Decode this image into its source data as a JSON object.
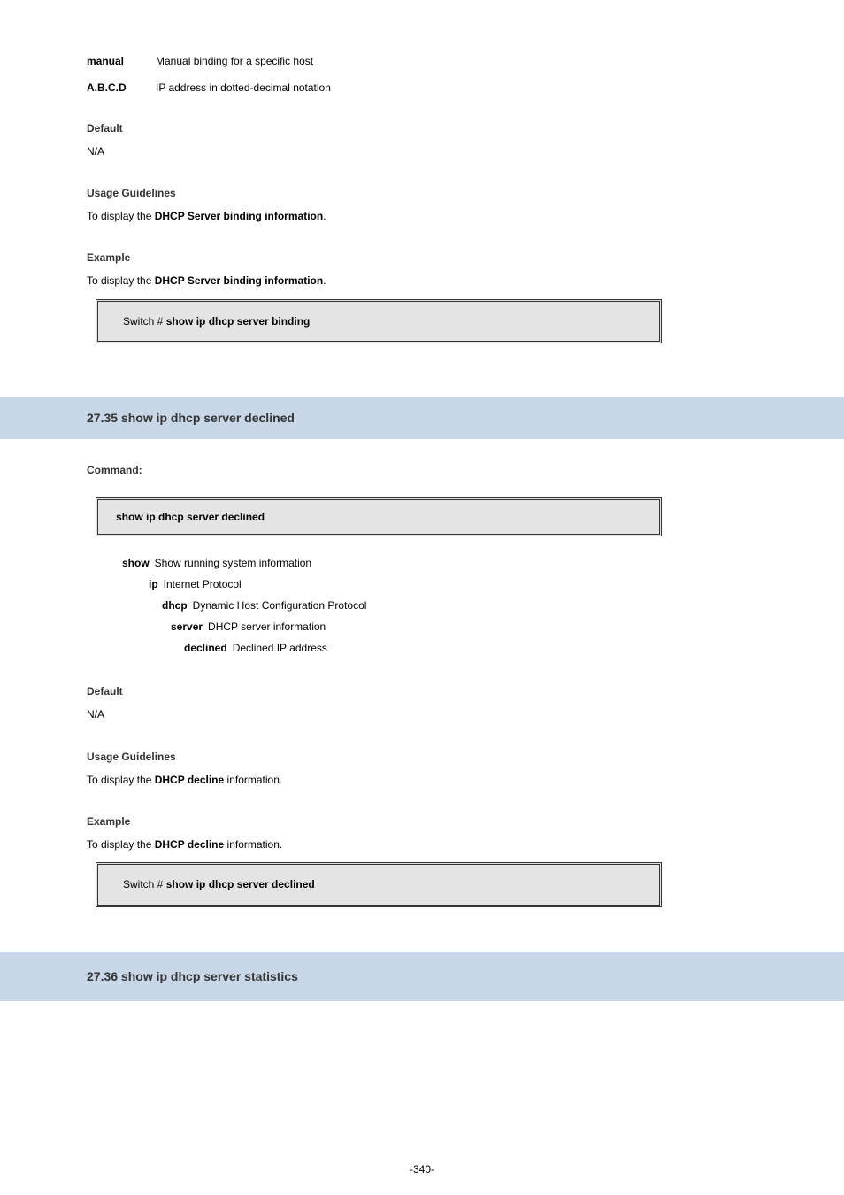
{
  "sec1": {
    "def1_term": "manual",
    "def1_desc": "Manual binding for a specific host",
    "def2_term": "A.B.C.D",
    "def2_desc": "IP address in dotted-decimal notation",
    "default_label": "Default",
    "default_value": "N/A",
    "usage_label": "Usage Guidelines",
    "usage_pre": "To display the ",
    "usage_bold": "DHCP Server binding information",
    "usage_post": ".",
    "example_label": "Example",
    "example_pre": "To display the ",
    "example_bold": "DHCP Server binding information",
    "example_post": ".",
    "code_prompt": "Switch # ",
    "code_cmd": "show ip dhcp server binding"
  },
  "sec2": {
    "header": "27.35 show ip dhcp server declined",
    "command_label": "Command:",
    "syntax": "show ip dhcp server declined",
    "tree": {
      "l1_key": "show",
      "l1_desc": "Show running system information",
      "l2_key": "ip",
      "l2_desc": "Internet Protocol",
      "l3_key": "dhcp",
      "l3_desc": "Dynamic Host Configuration Protocol",
      "l4_key": "server",
      "l4_desc": "DHCP server information",
      "l5_key": "declined",
      "l5_desc": "Declined IP address"
    },
    "default_label": "Default",
    "default_value": "N/A",
    "usage_label": "Usage Guidelines",
    "usage_pre": "To display the ",
    "usage_bold": "DHCP decline",
    "usage_post": " information.",
    "example_label": "Example",
    "example_pre": "To display the ",
    "example_bold": "DHCP decline",
    "example_post": " information.",
    "code_prompt": "Switch # ",
    "code_cmd": "show ip dhcp server declined"
  },
  "sec3": {
    "header": "27.36 show ip dhcp server statistics"
  },
  "page_number": "-340-"
}
